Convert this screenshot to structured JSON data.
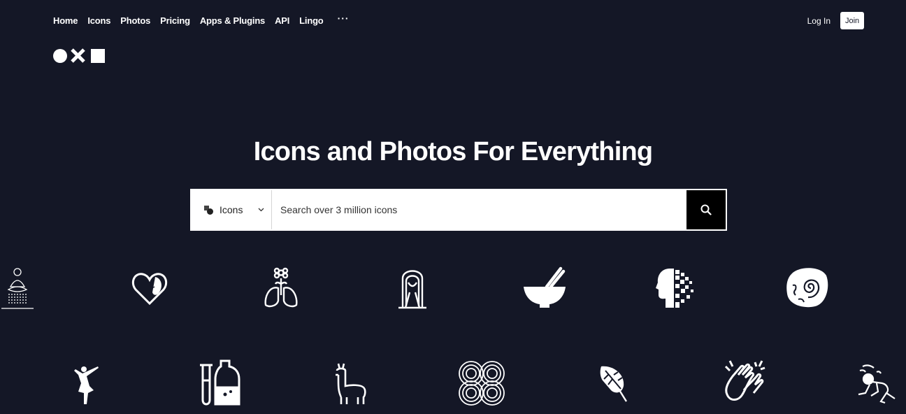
{
  "nav": {
    "items": [
      "Home",
      "Icons",
      "Photos",
      "Pricing",
      "Apps & Plugins",
      "API",
      "Lingo"
    ],
    "more": "···"
  },
  "auth": {
    "login": "Log In",
    "join": "Join"
  },
  "hero": {
    "title": "Icons and Photos For Everything"
  },
  "search": {
    "type_label": "Icons",
    "placeholder": "Search over 3 million icons"
  },
  "icons_row1": [
    "meditating-person-icon",
    "heart-face-icon",
    "flower-lungs-icon",
    "long-haired-woman-icon",
    "mortar-pestle-icon",
    "pixel-head-icon",
    "fossil-shell-icon"
  ],
  "icons_row2": [
    "dancing-woman-icon",
    "test-tube-bottle-icon",
    "llama-icon",
    "infinity-circles-icon",
    "monstera-leaf-icon",
    "clapping-hands-icon",
    "breakdancer-icon"
  ],
  "colors": {
    "background": "#141726",
    "foreground": "#ffffff",
    "search_button": "#000000"
  }
}
